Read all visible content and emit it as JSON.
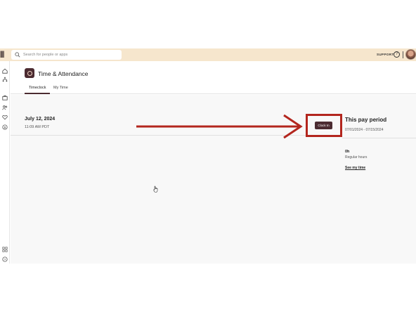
{
  "topbar": {
    "logo": "|||",
    "search_placeholder": "Search for people or apps",
    "support_label": "SUPPORT",
    "help_glyph": "?"
  },
  "sidebar": {
    "icons": [
      "home-icon",
      "org-chart-icon",
      "briefcase-icon",
      "people-icon",
      "heart-icon",
      "dollar-icon",
      "apps-icon",
      "help-icon"
    ]
  },
  "app": {
    "title": "Time & Attendance",
    "tabs": [
      {
        "label": "Timeclock",
        "active": true
      },
      {
        "label": "My Time",
        "active": false
      }
    ]
  },
  "clock": {
    "date": "July 12, 2024",
    "time": "11:09 AM PDT",
    "button_label": "Clock In"
  },
  "pay_period": {
    "title": "This pay period",
    "range": "07/01/2024 - 07/15/2024",
    "hours": "0h",
    "hours_label": "Regular hours",
    "link_label": "See my time"
  },
  "colors": {
    "brand": "#4b2b31",
    "topbar_bg": "#f6e6cd",
    "annotation": "#b3261e"
  }
}
